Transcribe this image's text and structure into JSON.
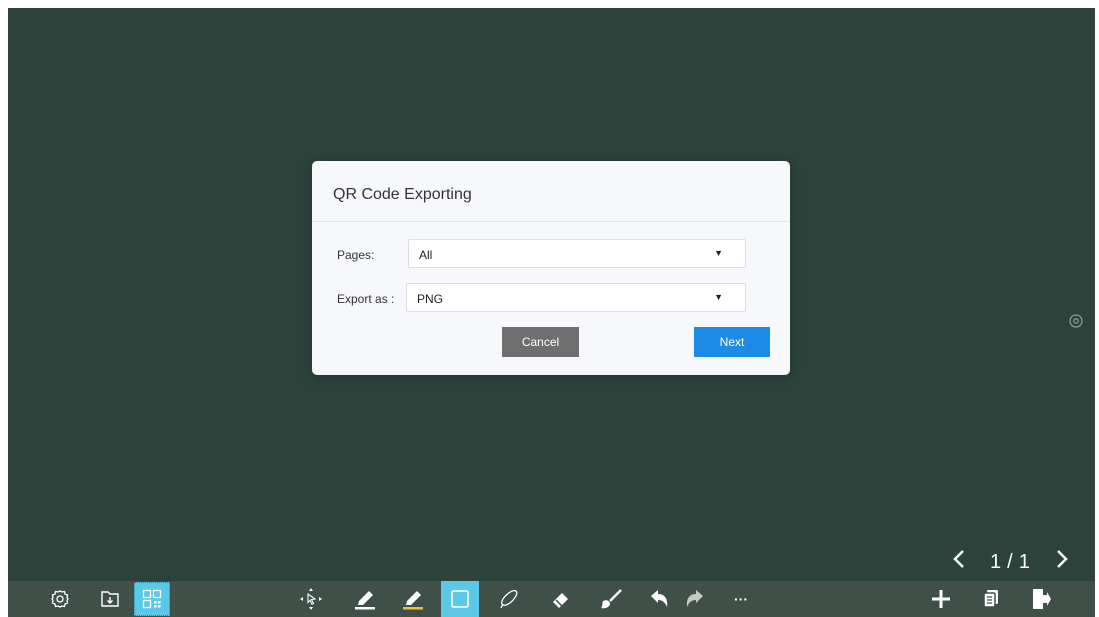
{
  "dialog": {
    "title": "QR Code Exporting",
    "pages_label": "Pages:",
    "pages_value": "All",
    "export_label": "Export as :",
    "export_value": "PNG",
    "cancel_label": "Cancel",
    "next_label": "Next"
  },
  "pager": {
    "current": "1",
    "separator": "/",
    "total": "1"
  },
  "toolbar": {
    "more_label": "···",
    "icons": [
      "gear-icon",
      "import-icon",
      "qr-code-icon",
      "move-select-icon",
      "pen-icon",
      "highlighter-icon",
      "rectangle-icon",
      "lasso-icon",
      "eraser-icon",
      "brush-icon",
      "undo-icon",
      "redo-icon",
      "more-icon",
      "add-page-icon",
      "pages-icon",
      "exit-icon"
    ],
    "active_tool": "rectangle-icon"
  },
  "colors": {
    "board": "#2b433b",
    "toolbar": "#3e5048",
    "accent": "#1f8ae6",
    "active_tool": "#5bc8e8"
  }
}
